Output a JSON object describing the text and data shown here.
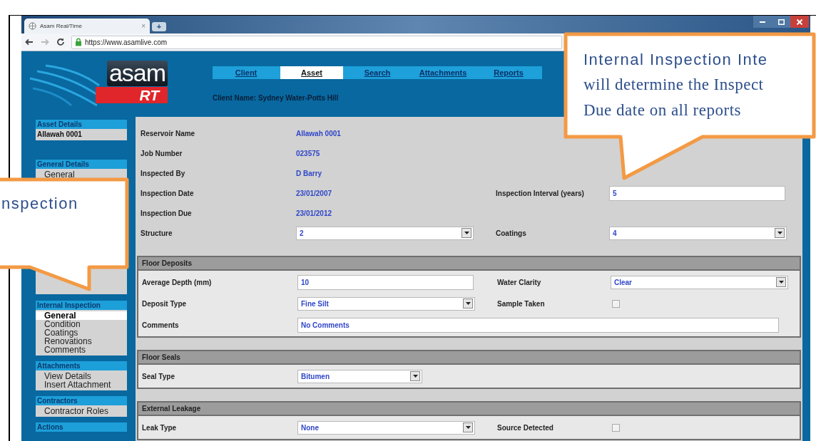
{
  "browser": {
    "tab": {
      "title": "Asam Real/Time",
      "close": "×"
    },
    "new_tab": "+",
    "url": "https://www.asamlive.com"
  },
  "app": {
    "logo": {
      "word": "asam",
      "badge": "RT"
    },
    "nav": [
      {
        "label": "Client",
        "selected": false
      },
      {
        "label": "Asset",
        "selected": true
      },
      {
        "label": "Search",
        "selected": false
      },
      {
        "label": "Attachments",
        "selected": false
      },
      {
        "label": "Reports",
        "selected": false
      }
    ],
    "client_name": "Client Name: Sydney Water-Potts Hill"
  },
  "sidebar": [
    {
      "heading": "Asset Details",
      "items": [
        {
          "label": "Allawah 0001",
          "kind": "value",
          "selected": false
        }
      ]
    },
    {
      "heading": "General Details",
      "items": [
        {
          "label": "General",
          "kind": "link",
          "selected": false
        }
      ]
    },
    {
      "heading": "Internal Inspection",
      "items": [
        {
          "label": "General",
          "kind": "link",
          "selected": true
        },
        {
          "label": "Condition",
          "kind": "link",
          "selected": false
        },
        {
          "label": "Coatings",
          "kind": "link",
          "selected": false
        },
        {
          "label": "Renovations",
          "kind": "link",
          "selected": false
        },
        {
          "label": "Comments",
          "kind": "link",
          "selected": false
        }
      ]
    },
    {
      "heading": "Attachments",
      "items": [
        {
          "label": "View Details",
          "kind": "link",
          "selected": false
        },
        {
          "label": "Insert Attachment",
          "kind": "link",
          "selected": false
        }
      ]
    },
    {
      "heading": "Contractors",
      "items": [
        {
          "label": "Contractor Roles",
          "kind": "link",
          "selected": false
        }
      ]
    },
    {
      "heading": "Actions"
    }
  ],
  "main": {
    "rows": [
      [
        {
          "label": "Reservoir Name",
          "kind": "text",
          "value": "Allawah 0001"
        }
      ],
      [
        {
          "label": "Job Number",
          "kind": "text",
          "value": "023575"
        }
      ],
      [
        {
          "label": "Inspected By",
          "kind": "text",
          "value": "D Barry"
        }
      ],
      [
        {
          "label": "Inspection Date",
          "kind": "text",
          "value": "23/01/2007"
        },
        {
          "label": "Inspection Interval (years)",
          "kind": "input",
          "value": "5"
        }
      ],
      [
        {
          "label": "Inspection Due",
          "kind": "text",
          "value": "23/01/2012"
        }
      ],
      [
        {
          "label": "Structure",
          "kind": "select",
          "value": "2"
        },
        {
          "label": "Coatings",
          "kind": "select",
          "value": "4"
        }
      ]
    ],
    "sections": [
      {
        "title": "Floor Deposits",
        "rows": [
          [
            {
              "label": "Average Depth (mm)",
              "kind": "input",
              "value": "10"
            },
            {
              "label": "Water Clarity",
              "kind": "select",
              "value": "Clear"
            }
          ],
          [
            {
              "label": "Deposit Type",
              "kind": "select",
              "value": "Fine Silt"
            },
            {
              "label": "Sample Taken",
              "kind": "checkbox",
              "checked": false
            }
          ],
          [
            {
              "label": "Comments",
              "kind": "input",
              "value": "No Comments"
            }
          ]
        ]
      },
      {
        "title": "Floor Seals",
        "rows": [
          [
            {
              "label": "Seal Type",
              "kind": "select",
              "value": "Bitumen"
            }
          ]
        ]
      },
      {
        "title": "External Leakage",
        "rows": [
          [
            {
              "label": "Leak Type",
              "kind": "select",
              "value": "None"
            },
            {
              "label": "Source Detected",
              "kind": "checkbox",
              "checked": false
            }
          ]
        ]
      }
    ]
  },
  "callouts": [
    {
      "lines": [
        "Internal Inspection Inte",
        "will determine the Inspect",
        "Due date on all reports"
      ]
    },
    {
      "lines": [
        "nspection"
      ]
    }
  ]
}
